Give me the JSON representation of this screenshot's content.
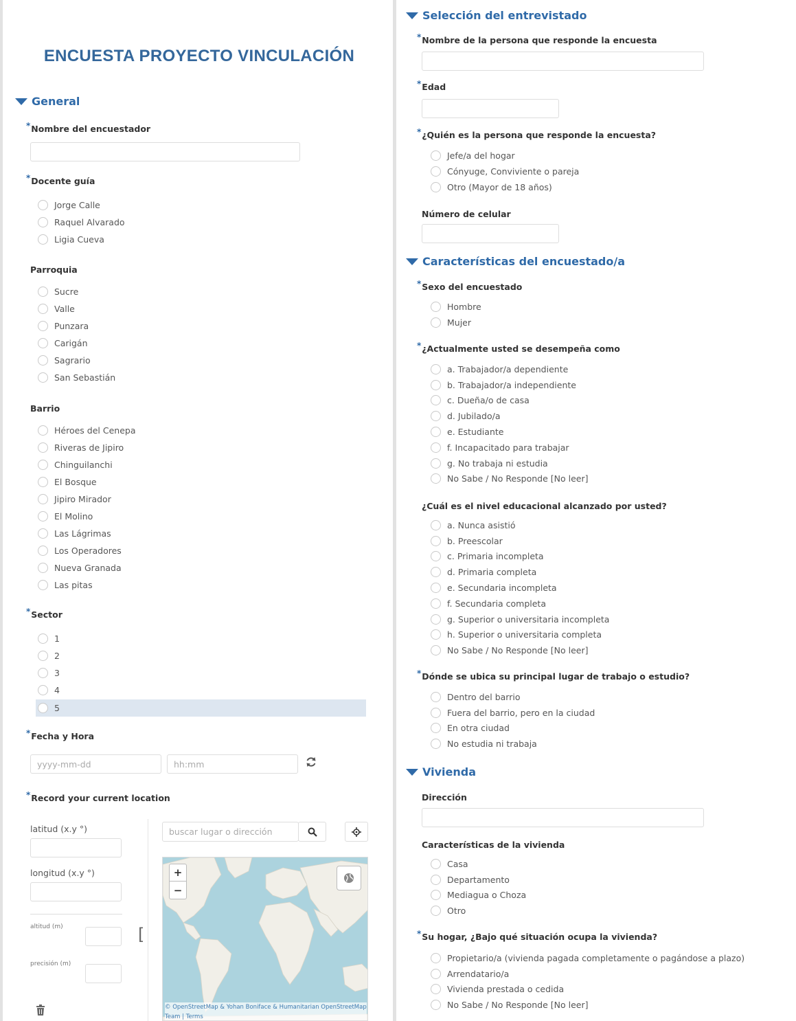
{
  "left": {
    "form_title": "ENCUESTA PROYECTO VINCULACIÓN",
    "section_general": "General",
    "q_encuestador": "Nombre del encuestador",
    "q_docente": "Docente guía",
    "docente_options": [
      "Jorge Calle",
      "Raquel Alvarado",
      "Ligia Cueva"
    ],
    "q_parroquia": "Parroquia",
    "parroquia_options": [
      "Sucre",
      "Valle",
      "Punzara",
      "Carigán",
      "Sagrario",
      "San Sebastián"
    ],
    "q_barrio": "Barrio",
    "barrio_options": [
      "Héroes del Cenepa",
      "Riveras de Jipiro",
      "Chinguilanchi",
      "El Bosque",
      "Jipiro Mirador",
      "El Molino",
      "Las Lágrimas",
      "Los Operadores",
      "Nueva Granada",
      "Las pitas"
    ],
    "q_sector": "Sector",
    "sector_options": [
      "1",
      "2",
      "3",
      "4",
      "5"
    ],
    "q_fecha": "Fecha y Hora",
    "date_placeholder": "yyyy-mm-dd",
    "time_placeholder": "hh:mm",
    "q_location": "Record your current location",
    "lat_label": "latitud (x.y °)",
    "lon_label": "longitud (x.y °)",
    "alt_label": "altitud (m)",
    "prec_label": "precisión (m)",
    "search_placeholder": "buscar lugar o dirección",
    "zoom_in": "+",
    "zoom_out": "−",
    "bracket": "[",
    "attribution_line1": "© OpenStreetMap & Yohan Boniface & Humanitarian OpenStreetMap",
    "attribution_line2": "Team | Terms",
    "icons": {
      "refresh": "refresh-icon",
      "search": "search-icon",
      "locate": "crosshair-icon",
      "layers": "globe-icon",
      "trash": "trash-icon"
    }
  },
  "right": {
    "section_entrevistado": "Selección del entrevistado",
    "q_nombre": "Nombre de la persona que responde la encuesta",
    "q_edad": "Edad",
    "q_quien": "¿Quién es la persona que responde la encuesta?",
    "quien_options": [
      "Jefe/a del hogar",
      "Cónyuge, Conviviente o pareja",
      "Otro (Mayor de 18 años)"
    ],
    "q_celular": "Número de celular",
    "section_caracteristicas": "Características del encuestado/a",
    "q_sexo": "Sexo del encuestado",
    "sexo_options": [
      "Hombre",
      "Mujer"
    ],
    "q_desempena": "¿Actualmente usted se desempeña como",
    "desempena_options": [
      "a. Trabajador/a dependiente",
      "b. Trabajador/a independiente",
      "c. Dueña/o de casa",
      "d. Jubilado/a",
      "e. Estudiante",
      "f. Incapacitado para trabajar",
      "g. No trabaja ni estudia",
      "No Sabe / No Responde [No leer]"
    ],
    "q_nivel": "¿Cuál es el nivel educacional alcanzado por usted?",
    "nivel_options": [
      "a. Nunca asistió",
      "b. Preescolar",
      "c. Primaria incompleta",
      "d. Primaria completa",
      "e. Secundaria incompleta",
      "f. Secundaria completa",
      "g. Superior o universitaria incompleta",
      "h. Superior o universitaria completa",
      "No Sabe / No Responde [No leer]"
    ],
    "q_lugar": "Dónde se ubica su principal lugar de trabajo o estudio?",
    "lugar_options": [
      "Dentro del barrio",
      "Fuera del barrio, pero en la ciudad",
      "En otra ciudad",
      "No estudia ni trabaja"
    ],
    "section_vivienda": "Vivienda",
    "q_direccion": "Dirección",
    "q_caract_vivienda": "Características de la vivienda",
    "vivienda_options": [
      "Casa",
      "Departamento",
      "Mediagua o Choza",
      "Otro"
    ],
    "q_situacion": "Su hogar, ¿Bajo qué situación ocupa la vivienda?",
    "situacion_options": [
      "Propietario/a (vivienda pagada completamente o pagándose a plazo)",
      "Arrendatario/a",
      "Vivienda prestada o cedida",
      "No Sabe / No Responde [No leer]"
    ]
  },
  "required_mark": "*",
  "colors": {
    "accent": "#2f6aa8",
    "title": "#34679b",
    "highlight": "#dde6f0",
    "map_water": "#acd3de",
    "map_land": "#f1efe8"
  }
}
